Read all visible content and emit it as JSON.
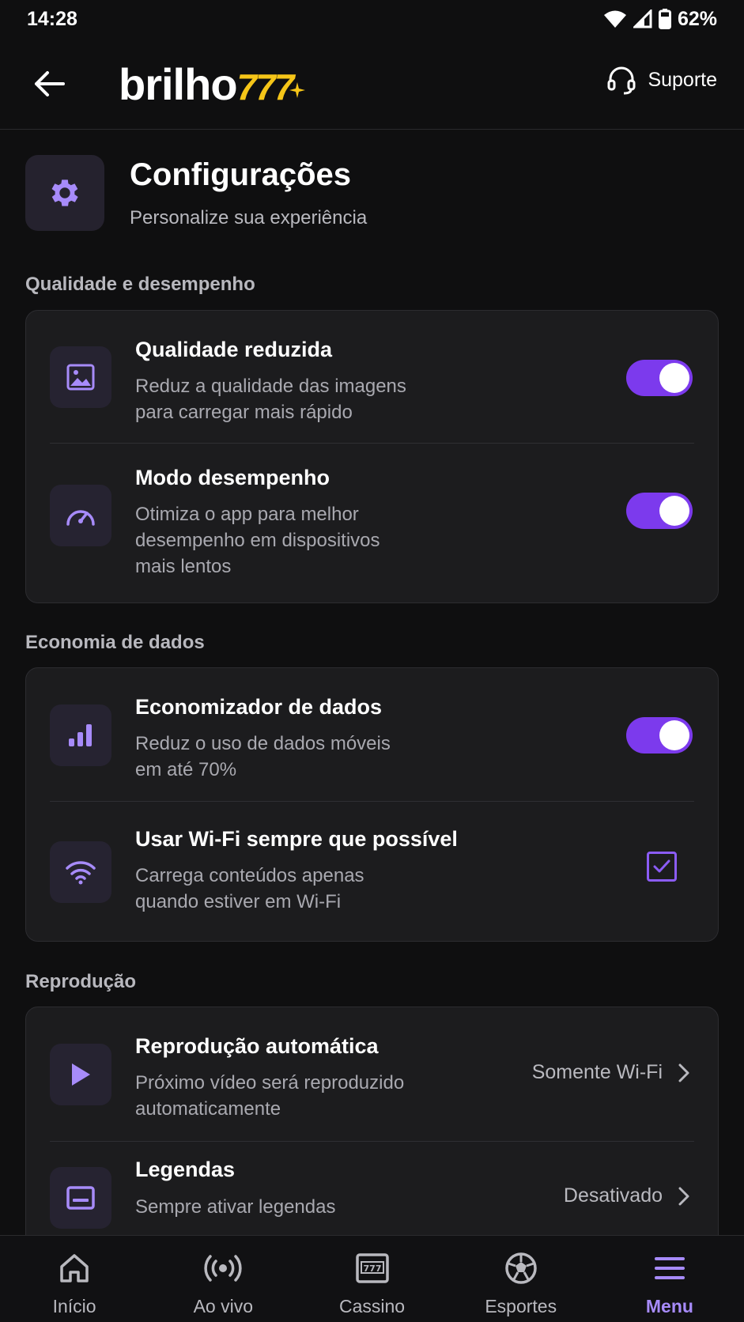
{
  "status_bar": {
    "time": "14:28",
    "battery": "62%"
  },
  "header": {
    "logo_word": "brilho",
    "logo_number": "777",
    "support_label": "Suporte"
  },
  "page": {
    "title": "Configurações",
    "subtitle": "Personalize sua experiência"
  },
  "sections": [
    {
      "label": "Qualidade e desempenho",
      "items": [
        {
          "title": "Qualidade reduzida",
          "desc_line1": "Reduz a qualidade das imagens",
          "desc_line2": "para carregar mais rápido",
          "control": "toggle",
          "on": true,
          "icon": "image-icon"
        },
        {
          "title": "Modo desempenho",
          "desc_line1": "Otimiza o app para melhor",
          "desc_line2": "desempenho em dispositivos",
          "desc_line3": "mais lentos",
          "control": "toggle",
          "on": true,
          "icon": "speedometer-icon"
        }
      ]
    },
    {
      "label": "Economia de dados",
      "items": [
        {
          "title": "Economizador de dados",
          "desc_line1": "Reduz o uso de dados móveis",
          "desc_line2": "em até 70%",
          "control": "toggle",
          "on": true,
          "icon": "bar-chart-icon"
        },
        {
          "title": "Usar Wi-Fi sempre que possível",
          "desc_line1": "Carrega conteúdos apenas",
          "desc_line2": "quando estiver em Wi-Fi",
          "control": "checkbox",
          "checked": true,
          "icon": "wifi-icon"
        }
      ]
    },
    {
      "label": "Reprodução",
      "items": [
        {
          "title": "Reprodução automática",
          "desc_line1": "Próximo vídeo será reproduzido",
          "desc_line2": "automaticamente",
          "control": "select",
          "value": "Somente Wi-Fi",
          "icon": "play-icon"
        },
        {
          "title": "Legendas",
          "desc_line1": "Sempre ativar legendas",
          "control": "select",
          "value": "Desativado",
          "icon": "subtitles-icon"
        }
      ]
    }
  ],
  "bottom_nav": [
    {
      "label": "Início",
      "icon": "home-icon"
    },
    {
      "label": "Ao vivo",
      "icon": "live-icon"
    },
    {
      "label": "Cassino",
      "icon": "slot-machine-icon"
    },
    {
      "label": "Esportes",
      "icon": "soccer-ball-icon"
    },
    {
      "label": "Menu",
      "icon": "menu-icon",
      "active": true
    }
  ],
  "colors": {
    "accent": "#7c3aed",
    "accent_light": "#a78bfa",
    "logo_gold": "#f5c518",
    "background": "#0f0f10",
    "card": "#1c1c1e"
  }
}
